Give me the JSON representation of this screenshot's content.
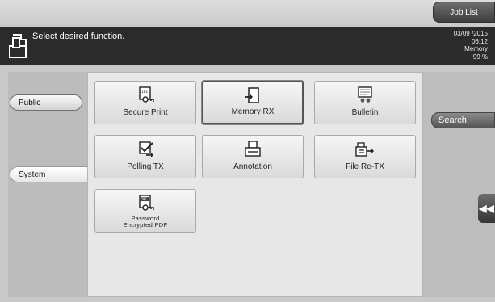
{
  "header": {
    "job_list_label": "Job List",
    "message": "Select desired function.",
    "status": {
      "date": "03/09 /2015",
      "time": "06:12",
      "memory_label": "Memory",
      "memory_value": "99 %"
    }
  },
  "left": {
    "categories": [
      {
        "label": "Public"
      },
      {
        "label": "System"
      }
    ]
  },
  "tiles": [
    {
      "label": "Secure Print",
      "icon": "secure-print-icon"
    },
    {
      "label": "Memory RX",
      "icon": "memory-rx-icon",
      "selected": true
    },
    {
      "label": "Bulletin",
      "icon": "bulletin-icon"
    },
    {
      "label": "Polling TX",
      "icon": "polling-tx-icon"
    },
    {
      "label": "Annotation",
      "icon": "annotation-icon"
    },
    {
      "label": "File Re-TX",
      "icon": "file-re-tx-icon"
    },
    {
      "label_line1": "Password",
      "label_line2": "Encrypted PDF",
      "icon": "password-pdf-icon"
    }
  ],
  "right": {
    "search_label": "Search",
    "back_glyph": "◀◀"
  },
  "colors": {
    "message_bar": "#2b2b2b",
    "tile_background": "#e7e7e7"
  }
}
